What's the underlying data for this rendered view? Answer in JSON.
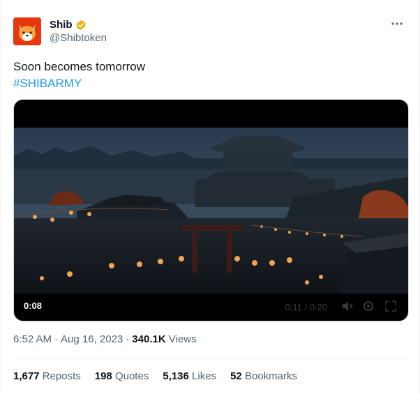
{
  "author": {
    "name": "Shib",
    "handle": "@Shibtoken",
    "verified_color": "#e2b719"
  },
  "tweet": {
    "text": "Soon becomes tomorrow",
    "hashtag": "#SHIBARMY"
  },
  "video": {
    "elapsed": "0:08",
    "position": "0:11 / 0:20"
  },
  "meta": {
    "time": "6:52 AM",
    "separator": "·",
    "date": "Aug 16, 2023",
    "views_count": "340.1K",
    "views_label": "Views"
  },
  "stats": {
    "reposts_count": "1,677",
    "reposts_label": "Reposts",
    "quotes_count": "198",
    "quotes_label": "Quotes",
    "likes_count": "5,136",
    "likes_label": "Likes",
    "bookmarks_count": "52",
    "bookmarks_label": "Bookmarks"
  },
  "more_icon": "…",
  "colors": {
    "link": "#1d9bf0",
    "muted": "#536471",
    "avatar_bg": "#e7380d"
  }
}
